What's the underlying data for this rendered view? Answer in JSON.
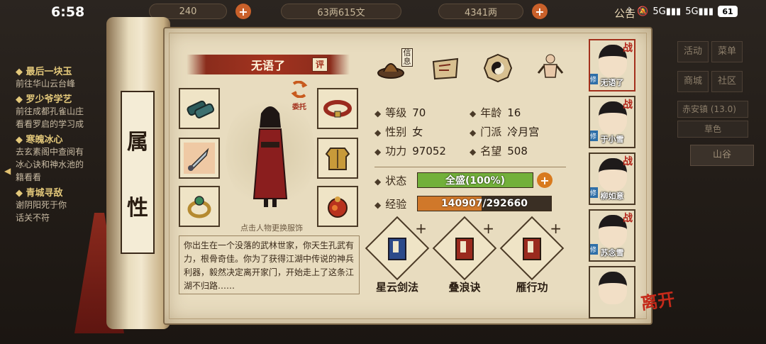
{
  "status_bar": {
    "time": "6:58",
    "battery": "61"
  },
  "top_resources": {
    "stamina": "240",
    "money": "63两615文",
    "ingots": "4341两",
    "announcement": "公告"
  },
  "quests": [
    {
      "title": "最后一块玉",
      "lines": [
        "前往华山云台峰"
      ]
    },
    {
      "title": "罗少爷学艺",
      "lines": [
        "前往成都孔雀山庄",
        "看看罗启的学习成"
      ]
    },
    {
      "title": "寒魄冰心",
      "lines": [
        "去玄素阁中查阅有",
        "冰心诀和神水池的",
        "籍看看"
      ]
    },
    {
      "title": "青城寻敌",
      "lines": [
        "谢阴阳死于你",
        "话关不符"
      ]
    }
  ],
  "right_panel": {
    "buttons": [
      "活动",
      "菜单",
      "商城",
      "社区"
    ],
    "location": "赤安镇",
    "location_code": "(13.0)",
    "tag": "草色",
    "area": "山谷"
  },
  "scroll_title": [
    "属",
    "性"
  ],
  "character": {
    "name": "无语了",
    "review_badge": "评",
    "entrust_label": "委托",
    "hint": "点击人物更换服饰",
    "bio": "你出生在一个没落的武林世家，你天生孔武有力，根骨奇佳。你为了获得江湖中传说的神兵利器，毅然决定离开家门，开始走上了这条江湖不归路……"
  },
  "tabs": {
    "info_label": "信息"
  },
  "stats": {
    "level_label": "等级",
    "level": "70",
    "age_label": "年龄",
    "age": "16",
    "gender_label": "性别",
    "gender": "女",
    "sect_label": "门派",
    "sect": "冷月宫",
    "power_label": "功力",
    "power": "97052",
    "fame_label": "名望",
    "fame": "508",
    "state_label": "状态",
    "state": "全盛(100%)",
    "state_fraction": 1.0,
    "exp_label": "经验",
    "exp": "140907/292660",
    "exp_fraction": 0.481
  },
  "skills": [
    {
      "name": "星云剑法"
    },
    {
      "name": "叠浪诀"
    },
    {
      "name": "雁行功"
    }
  ],
  "roster": [
    {
      "name": "无语了",
      "active": true,
      "fight": "战",
      "cultivate": "修"
    },
    {
      "name": "于小雪",
      "active": false,
      "fight": "战",
      "cultivate": "修"
    },
    {
      "name": "柳如意",
      "active": false,
      "fight": "战",
      "cultivate": "修"
    },
    {
      "name": "苏念雪",
      "active": false,
      "fight": "战",
      "cultivate": "修"
    },
    {
      "name": "",
      "active": false,
      "fight": "",
      "cultivate": ""
    }
  ],
  "leave_label": "离开",
  "colors": {
    "accent_red": "#a3301c",
    "state_bar": "#72b03a",
    "exp_bar": "#d0782a",
    "paper": "#e8dcbf"
  }
}
